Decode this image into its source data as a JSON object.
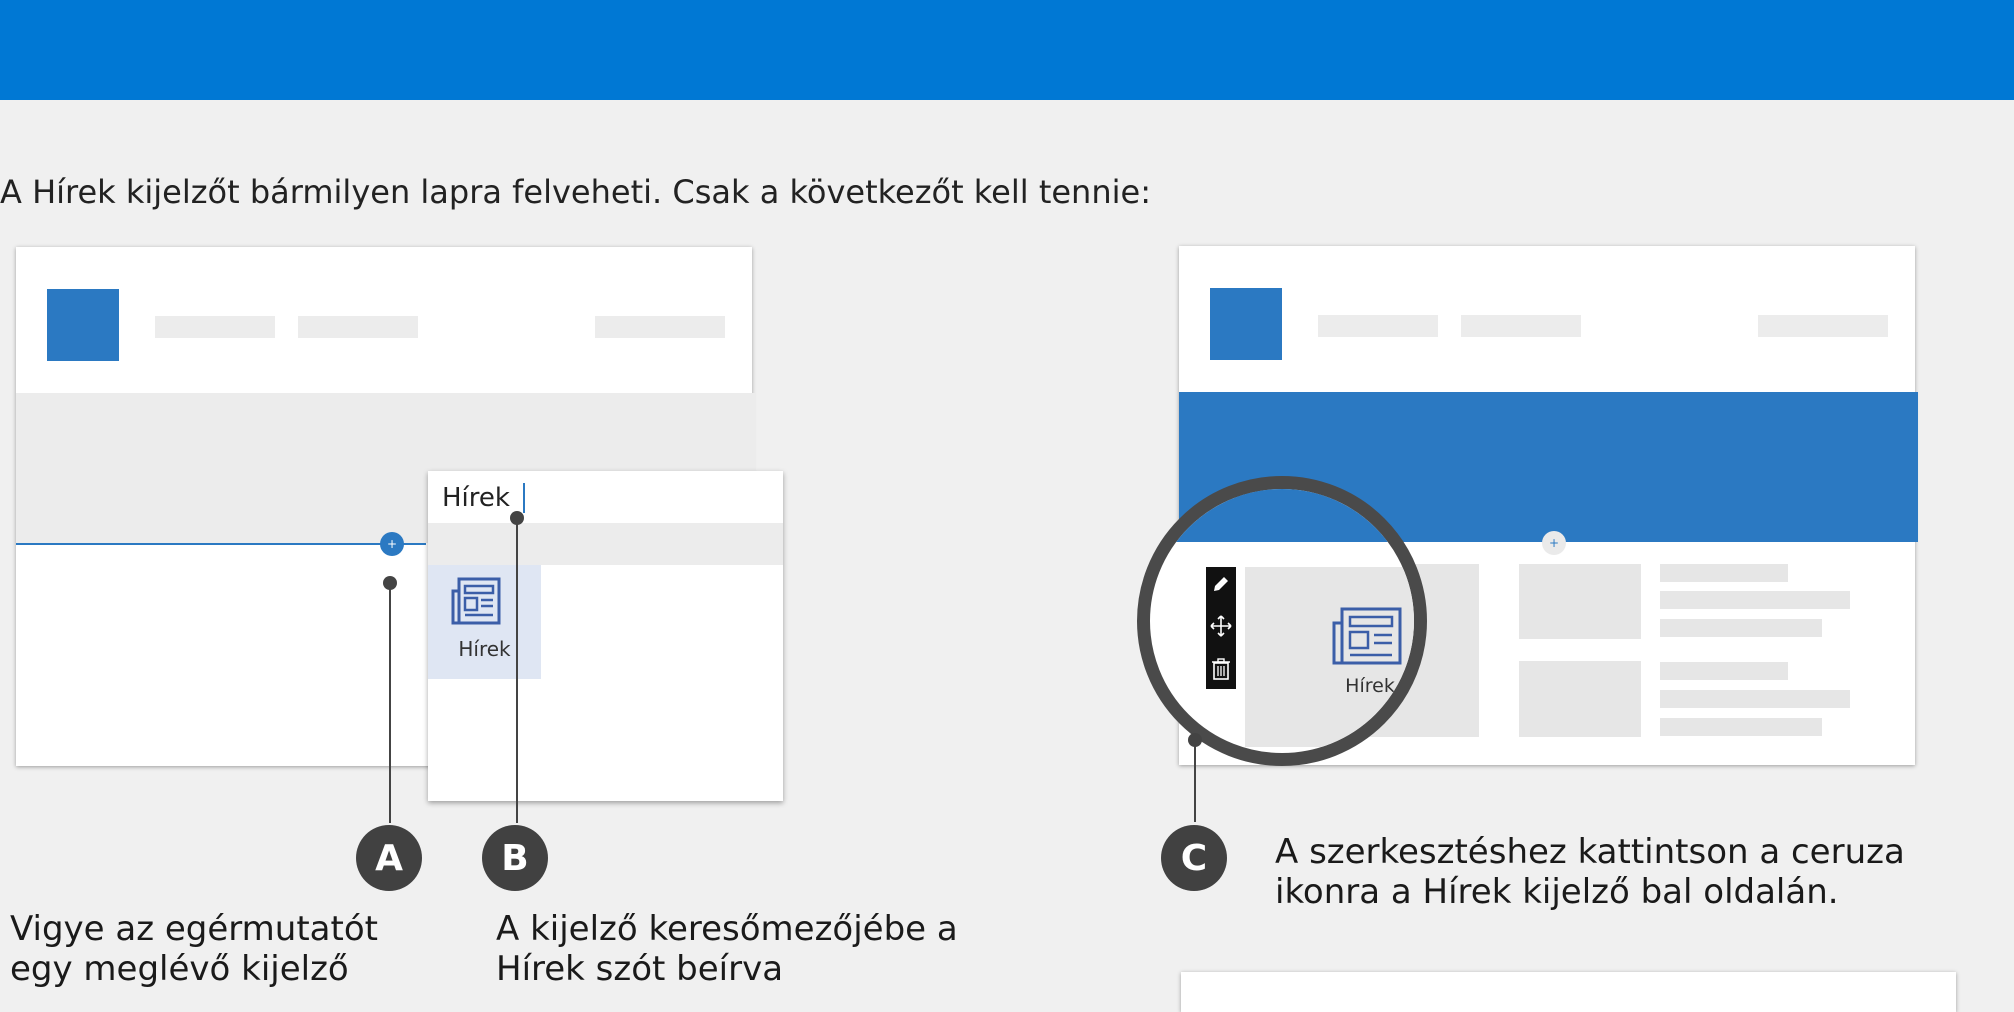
{
  "intro": "A Hírek kijelzőt bármilyen lapra felveheti. Csak a következőt kell tennie:",
  "search": {
    "value": "Hírek"
  },
  "tile_label": "Hírek",
  "magnified_label": "Hírek",
  "steps": [
    {
      "badge": "A",
      "text": "Vigye az egérmutatót egy meglévő kijelző"
    },
    {
      "badge": "B",
      "text": "A kijelző keresőmezőjébe a Hírek szót beírva"
    },
    {
      "badge": "C",
      "text": "A szerkesztéshez kattintson a ceruza ikonra a Hírek kijelző bal oldalán."
    }
  ],
  "icons": [
    "plus-icon",
    "news-icon",
    "pencil-icon",
    "move-icon",
    "trash-icon"
  ],
  "colors": {
    "header": "#0078d4",
    "accent": "#2b79c2",
    "callout": "#414141",
    "tile": "#dfe6f3",
    "news_icon": "#3b5ea8"
  }
}
